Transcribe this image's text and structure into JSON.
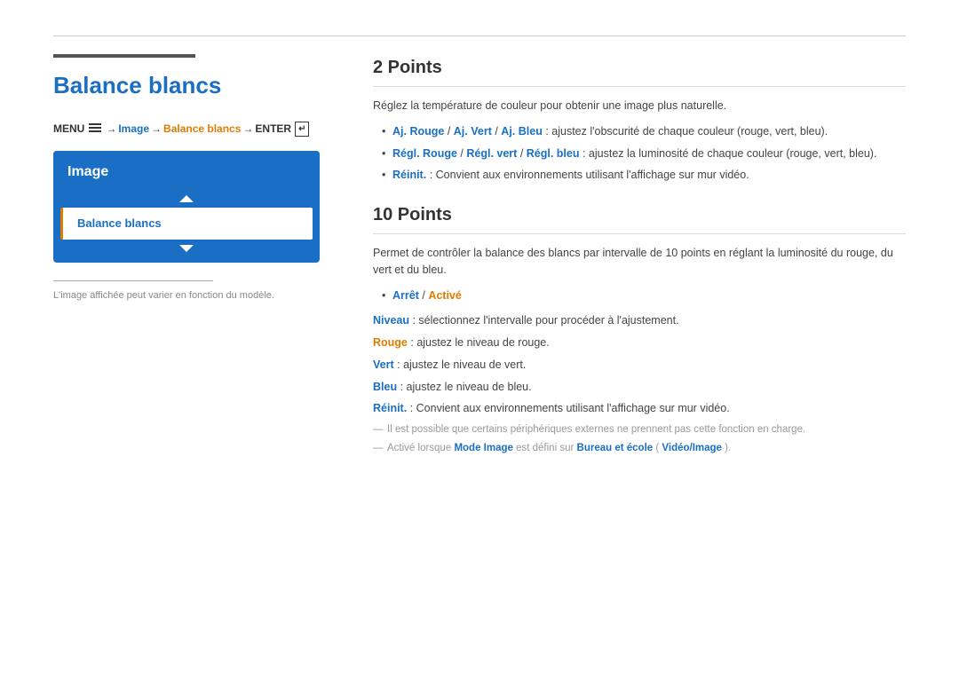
{
  "page": {
    "title": "Balance blancs",
    "top_rule": true
  },
  "menu_path": {
    "menu_label": "MENU",
    "arrow1": "→",
    "image_label": "Image",
    "arrow2": "→",
    "balance_label": "Balance blancs",
    "arrow3": "→",
    "enter_label": "ENTER"
  },
  "nav_box": {
    "header": "Image",
    "selected_item": "Balance blancs"
  },
  "footnote": "L'image affichée peut varier en fonction du modèle.",
  "section_2points": {
    "title": "2 Points",
    "intro": "Réglez la température de couleur pour obtenir une image plus naturelle.",
    "bullets": [
      {
        "parts": [
          {
            "text": "Aj. Rouge",
            "style": "blue-bold"
          },
          {
            "text": " / ",
            "style": "normal"
          },
          {
            "text": "Aj. Vert",
            "style": "blue-bold"
          },
          {
            "text": " / ",
            "style": "normal"
          },
          {
            "text": "Aj. Bleu",
            "style": "blue-bold"
          },
          {
            "text": " : ajustez l'obscurité de chaque couleur (rouge, vert, bleu).",
            "style": "normal"
          }
        ]
      },
      {
        "parts": [
          {
            "text": "Régl. Rouge",
            "style": "blue-bold"
          },
          {
            "text": " / ",
            "style": "normal"
          },
          {
            "text": "Régl. vert",
            "style": "blue-bold"
          },
          {
            "text": " / ",
            "style": "normal"
          },
          {
            "text": "Régl. bleu",
            "style": "blue-bold"
          },
          {
            "text": " : ajustez la luminosité de chaque couleur (rouge, vert, bleu).",
            "style": "normal"
          }
        ]
      },
      {
        "parts": [
          {
            "text": "Réinit.",
            "style": "blue-bold"
          },
          {
            "text": ": Convient aux environnements utilisant l'affichage sur mur vidéo.",
            "style": "normal"
          }
        ]
      }
    ]
  },
  "section_10points": {
    "title": "10 Points",
    "intro": "Permet de contrôler la balance des blancs par intervalle de 10 points en réglant la luminosité du rouge, du vert et du bleu.",
    "bullet_arret": "Arrêt",
    "bullet_active": "Activé",
    "lines": [
      {
        "label": "Niveau",
        "label_style": "blue-bold",
        "text": " : sélectionnez l'intervalle pour procéder à l'ajustement."
      },
      {
        "label": "Rouge",
        "label_style": "orange-bold",
        "text": " : ajustez le niveau de rouge."
      },
      {
        "label": "Vert",
        "label_style": "blue-bold",
        "text": " : ajustez le niveau de vert."
      },
      {
        "label": "Bleu",
        "label_style": "blue-bold",
        "text": " : ajustez le niveau de bleu."
      },
      {
        "label": "Réinit.",
        "label_style": "blue-bold",
        "text": ": Convient aux environnements utilisant l'affichage sur mur vidéo."
      }
    ],
    "notes": [
      "Il est possible que certains périphériques externes ne prennent pas cette fonction en charge.",
      {
        "parts": [
          {
            "text": "Activé lorsque "
          },
          {
            "text": "Mode Image",
            "style": "blue-bold"
          },
          {
            "text": " est défini sur "
          },
          {
            "text": "Bureau et école",
            "style": "blue-bold"
          },
          {
            "text": " ("
          },
          {
            "text": "Vidéo/Image",
            "style": "blue-bold"
          },
          {
            "text": ")."
          }
        ]
      }
    ]
  }
}
